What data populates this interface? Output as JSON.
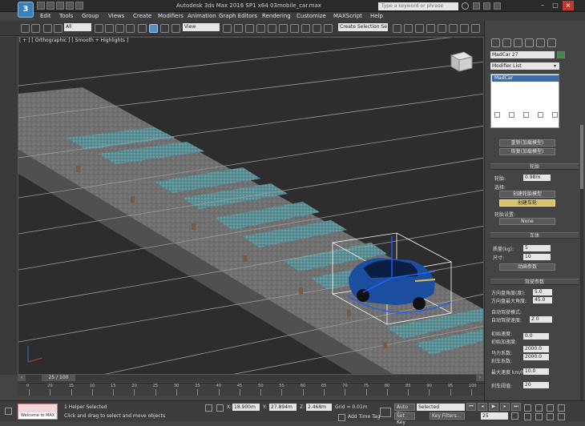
{
  "titlebar": {
    "logo": "3",
    "title": "Autodesk 3ds Max  2016 SP1 x64     03mobile_car.max",
    "search_placeholder": "Type a keyword or phrase"
  },
  "menu": [
    "Edit",
    "Tools",
    "Group",
    "Views",
    "Create",
    "Modifiers",
    "Animation",
    "Graph Editors",
    "Rendering",
    "Customize",
    "MAXScript",
    "Help"
  ],
  "toolbar": {
    "filter_select": "All",
    "ref_coord_select": "View",
    "named_selection_select": "Create Selection Se"
  },
  "viewport": {
    "label": "[ + ] [ Orthographic ] [ Smooth + Highlights ]"
  },
  "command_panel": {
    "object_name": "MadCar 27",
    "modifier_list": "Modifier List",
    "stack_item": "MadCar",
    "rollout_top_buttons": [
      "重新(加载模型)",
      "恢复(加载模型)"
    ],
    "rollout1_title": "轮胎",
    "rollout1_label_radius": "轮胎:",
    "rollout1_value_radius": "0.98m",
    "rollout1_label_2": "选择:",
    "rollout1_btn_1": "创建轮胎模型",
    "rollout1_btn_2": "创建车轮",
    "rollout1_label_3": "轮胎设置:",
    "rollout1_value_3": "None",
    "rollout2_title": "车体",
    "rollout2_label_1": "质量(kg):",
    "rollout2_value_1": "5",
    "rollout2_label_2": "尺寸:",
    "rollout2_value_2": "10",
    "rollout2_btn": "动画参数",
    "rollout3_title": "驾驶参数",
    "rollout3_rows": [
      {
        "label": "方向盘角度(度):",
        "value": "5.0"
      },
      {
        "label": "方向盘最大角度:",
        "value": "45.0"
      },
      {
        "label": "自动驾驶模式:",
        "value": ""
      },
      {
        "label": "自动驾驶速度:",
        "value": "2.0"
      },
      {
        "label": "初始速度:",
        "value": "0.0"
      },
      {
        "label": "初始加速度:",
        "value": ""
      },
      {
        "label": "马力系数:",
        "value": "2000.0"
      },
      {
        "label": "刹车系数:",
        "value": "2000.0"
      },
      {
        "label": "最大速度 km/h:",
        "value": "10.0"
      },
      {
        "label": "刹车阈值:",
        "value": "20"
      }
    ]
  },
  "timeline": {
    "frame_label": "25 / 100",
    "ticks": [
      "0",
      "20",
      "15",
      "10",
      "15",
      "20",
      "25",
      "30",
      "35",
      "40",
      "45",
      "50",
      "55",
      "60",
      "65",
      "70",
      "75",
      "80",
      "85",
      "90",
      "95",
      "100"
    ]
  },
  "status": {
    "maxscript_label": "Welcome to MAX",
    "line1": "1 Helper Selected",
    "line2": "Click and drag to select and move objects",
    "x_label": "X:",
    "x_value": "18.900m",
    "y_label": "Y:",
    "y_value": "27.894m",
    "z_label": "Z:",
    "z_value": "2.468m",
    "grid": "Grid = 0.01m",
    "add_time_tag": "Add Time Tag",
    "auto_key": "Auto Key",
    "set_key": "Set Key",
    "selected": "Selected",
    "key_filters": "Key Filters...",
    "frame": "25"
  }
}
